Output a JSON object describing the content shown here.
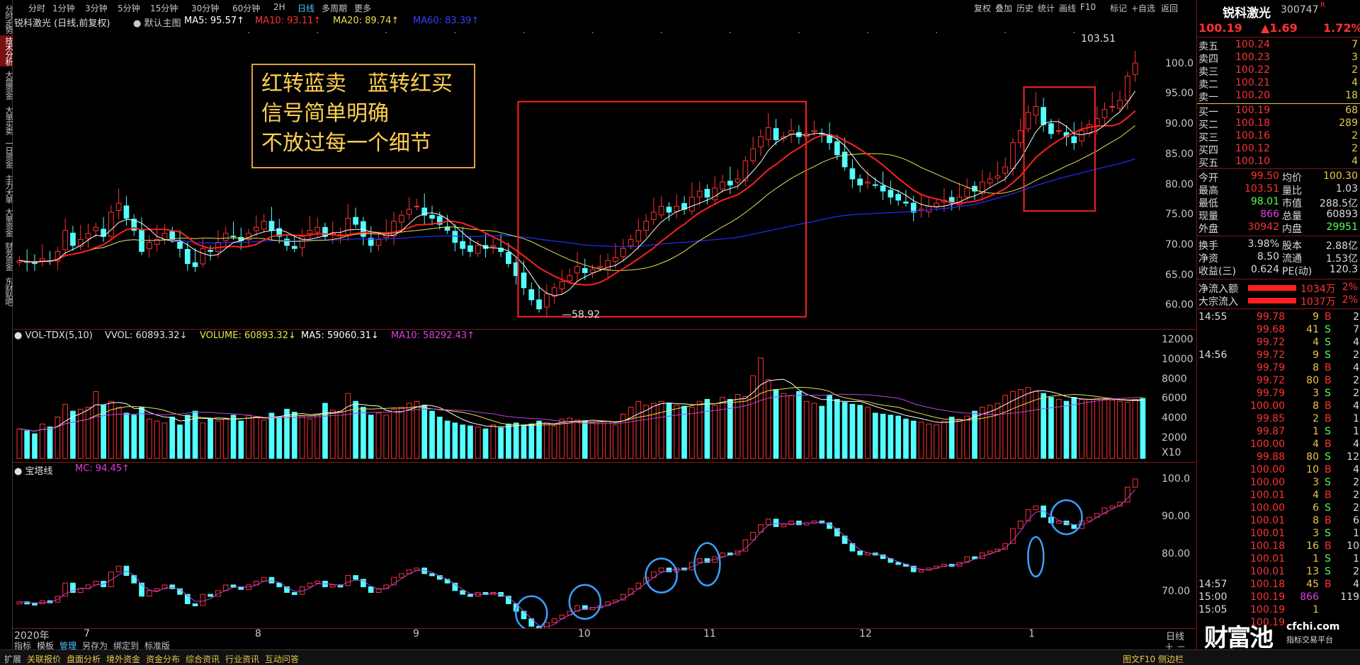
{
  "left_tabs": [
    "分时走势",
    "技术分析",
    "大盘资金",
    "大单买卖",
    "一日资金",
    "主力大单",
    "大单资金",
    "财务资金",
    "东财贴吧"
  ],
  "topbar": {
    "periods": [
      "分时",
      "1分钟",
      "3分钟",
      "5分钟",
      "15分钟",
      "30分钟",
      "60分钟",
      "2H",
      "日线",
      "多周期",
      "更多"
    ],
    "selected": "日线",
    "tools": [
      "复权",
      "叠加",
      "历史",
      "统计",
      "画线",
      "F10",
      "标记",
      "+自选",
      "返回"
    ]
  },
  "main_info": {
    "title": "锐科激光 (日线,前复权)",
    "template": "默认主图",
    "ma5": "MA5: 95.57↑",
    "ma10": "MA10: 93.11↑",
    "ma20": "MA20: 89.74↑",
    "ma60": "MA60: 83.39↑"
  },
  "annotation": [
    "红转蓝卖　蓝转红买",
    "信号简单明确",
    "不放过每一个细节"
  ],
  "price_labels": {
    "high": "103.51",
    "low": "58.92",
    "yaxis": [
      "100.0",
      "95.00",
      "90.00",
      "85.00",
      "80.00",
      "75.00",
      "70.00",
      "65.00",
      "60.00"
    ]
  },
  "vol_info": {
    "name": "VOL-TDX(5,10)",
    "vvol": "VVOL: 60893.32↓",
    "volume": "VOLUME: 60893.32↓",
    "ma5": "MA5: 59060.31↓",
    "ma10": "MA10: 58292.43↑",
    "yaxis": [
      "12000",
      "10000",
      "8000",
      "6000",
      "4000",
      "2000"
    ],
    "unit": "X10"
  },
  "tower_info": {
    "name": "宝塔线",
    "mc": "MC: 94.45↑",
    "yaxis": [
      "100.0",
      "90.00",
      "80.00",
      "70.00"
    ]
  },
  "xaxis": [
    "2020年",
    "7",
    "8",
    "9",
    "10",
    "11",
    "12",
    "1"
  ],
  "bottom_tools": [
    "指标",
    "模板",
    "管理",
    "另存为",
    "绑定到",
    "标准版"
  ],
  "period_label": "日线",
  "statusbar": [
    "扩展",
    "关联报价",
    "盘面分析",
    "境外资金",
    "资金分布",
    "综合资讯",
    "行业资讯",
    "互动问答"
  ],
  "status_right": "图文F10 侧边栏",
  "stock": {
    "name": "锐科激光",
    "code": "300747",
    "flag": "R",
    "price": "100.19",
    "change": "▲1.69",
    "pct": "1.72%"
  },
  "asks": [
    {
      "l": "卖五",
      "p": "100.24",
      "v": "7"
    },
    {
      "l": "卖四",
      "p": "100.23",
      "v": "3"
    },
    {
      "l": "卖三",
      "p": "100.22",
      "v": "2"
    },
    {
      "l": "卖二",
      "p": "100.21",
      "v": "4"
    },
    {
      "l": "卖一",
      "p": "100.20",
      "v": "18"
    }
  ],
  "bids": [
    {
      "l": "买一",
      "p": "100.19",
      "v": "68"
    },
    {
      "l": "买二",
      "p": "100.18",
      "v": "289"
    },
    {
      "l": "买三",
      "p": "100.16",
      "v": "2"
    },
    {
      "l": "买四",
      "p": "100.12",
      "v": "2"
    },
    {
      "l": "买五",
      "p": "100.10",
      "v": "4"
    }
  ],
  "stats1": [
    [
      "今开",
      "99.50",
      "均价",
      "100.30"
    ],
    [
      "最高",
      "103.51",
      "量比",
      "1.03"
    ],
    [
      "最低",
      "98.01",
      "市值",
      "288.5亿"
    ],
    [
      "现量",
      "866",
      "总量",
      "60893"
    ],
    [
      "外盘",
      "30942",
      "内盘",
      "29951"
    ]
  ],
  "stats2": [
    [
      "换手",
      "3.98%",
      "股本",
      "2.88亿"
    ],
    [
      "净资",
      "8.50",
      "流通",
      "1.53亿"
    ],
    [
      "收益(三)",
      "0.624",
      "PE(动)",
      "120.3"
    ]
  ],
  "flows": [
    {
      "l": "净流入额",
      "v": "1034万",
      "p": "2%"
    },
    {
      "l": "大宗流入",
      "v": "1037万",
      "p": "2%"
    }
  ],
  "ticks": [
    {
      "t": "14:55",
      "p": "99.78",
      "v": "9",
      "d": "B",
      "n": "2"
    },
    {
      "t": "",
      "p": "99.68",
      "v": "41",
      "d": "S",
      "n": "7"
    },
    {
      "t": "",
      "p": "99.72",
      "v": "4",
      "d": "S",
      "n": "4"
    },
    {
      "t": "14:56",
      "p": "99.72",
      "v": "9",
      "d": "S",
      "n": "2"
    },
    {
      "t": "",
      "p": "99.79",
      "v": "8",
      "d": "B",
      "n": "4"
    },
    {
      "t": "",
      "p": "99.72",
      "v": "80",
      "d": "B",
      "n": "2"
    },
    {
      "t": "",
      "p": "99.79",
      "v": "3",
      "d": "S",
      "n": "2"
    },
    {
      "t": "",
      "p": "100.00",
      "v": "8",
      "d": "B",
      "n": "4"
    },
    {
      "t": "",
      "p": "99.85",
      "v": "2",
      "d": "B",
      "n": "1"
    },
    {
      "t": "",
      "p": "99.87",
      "v": "1",
      "d": "S",
      "n": "1"
    },
    {
      "t": "",
      "p": "100.00",
      "v": "4",
      "d": "B",
      "n": "4"
    },
    {
      "t": "",
      "p": "99.88",
      "v": "80",
      "d": "S",
      "n": "12"
    },
    {
      "t": "",
      "p": "100.00",
      "v": "10",
      "d": "B",
      "n": "4"
    },
    {
      "t": "",
      "p": "100.00",
      "v": "3",
      "d": "S",
      "n": "2"
    },
    {
      "t": "",
      "p": "100.01",
      "v": "4",
      "d": "B",
      "n": "2"
    },
    {
      "t": "",
      "p": "100.00",
      "v": "6",
      "d": "S",
      "n": "2"
    },
    {
      "t": "",
      "p": "100.01",
      "v": "8",
      "d": "B",
      "n": "6"
    },
    {
      "t": "",
      "p": "100.01",
      "v": "3",
      "d": "S",
      "n": "1"
    },
    {
      "t": "",
      "p": "100.18",
      "v": "16",
      "d": "B",
      "n": "10"
    },
    {
      "t": "",
      "p": "100.01",
      "v": "1",
      "d": "S",
      "n": "1"
    },
    {
      "t": "",
      "p": "100.01",
      "v": "13",
      "d": "S",
      "n": "2"
    },
    {
      "t": "14:57",
      "p": "100.18",
      "v": "45",
      "d": "B",
      "n": "4"
    },
    {
      "t": "15:00",
      "p": "100.19",
      "v": "866",
      "d": "",
      "n": "119"
    },
    {
      "t": "15:05",
      "p": "100.19",
      "v": "1",
      "d": "",
      "n": ""
    },
    {
      "t": "",
      "p": "100.19",
      "v": "",
      "d": "",
      "n": ""
    }
  ],
  "watermark": {
    "main": "财富池",
    "site": "cfchi.com",
    "sub": "指标交易平台"
  },
  "colors": {
    "up": "#ff3232",
    "down": "#54ffff",
    "ma5": "#ffffff",
    "ma10": "#ff2020",
    "ma20": "#e8e050",
    "ma60": "#2030ff",
    "grid": "#7a1a1a",
    "annot": "#ffd050",
    "box": "#ff2020",
    "circle": "#3aa0ff"
  },
  "chart_data": {
    "type": "candlestick",
    "title": "锐科激光 (日线,前复权)",
    "ylim": [
      57,
      105
    ],
    "close": [
      67.5,
      67.2,
      67.0,
      67.8,
      67.4,
      69.0,
      72.5,
      70.0,
      71.0,
      72.0,
      73.0,
      71.5,
      75.5,
      77.0,
      74.5,
      72.5,
      69.0,
      70.5,
      71.0,
      72.0,
      71.0,
      69.5,
      67.0,
      66.5,
      69.5,
      69.0,
      70.5,
      72.0,
      71.5,
      70.8,
      72.0,
      73.0,
      74.0,
      72.5,
      71.5,
      70.0,
      69.5,
      71.5,
      72.5,
      73.0,
      71.5,
      72.0,
      71.8,
      74.5,
      73.5,
      71.5,
      70.0,
      71.0,
      72.0,
      74.0,
      75.0,
      76.0,
      76.5,
      75.0,
      74.5,
      73.5,
      72.5,
      70.5,
      69.5,
      69.0,
      70.0,
      69.5,
      70.0,
      69.0,
      67.0,
      65.0,
      63.0,
      61.0,
      59.5,
      62.0,
      63.0,
      64.0,
      65.0,
      66.5,
      65.5,
      66.0,
      66.5,
      67.5,
      68.0,
      69.5,
      71.0,
      72.5,
      74.0,
      75.5,
      76.5,
      75.5,
      76.5,
      76.0,
      78.0,
      79.0,
      78.0,
      79.5,
      80.5,
      80.0,
      81.0,
      84.0,
      86.0,
      88.0,
      89.5,
      87.5,
      88.0,
      89.0,
      88.0,
      88.5,
      89.0,
      88.5,
      87.0,
      85.0,
      83.0,
      81.0,
      80.0,
      80.5,
      80.0,
      79.0,
      78.0,
      77.5,
      77.0,
      75.5,
      76.0,
      76.5,
      77.0,
      77.5,
      77.0,
      78.0,
      79.5,
      79.0,
      80.5,
      81.0,
      81.5,
      83.0,
      87.0,
      89.0,
      92.0,
      93.0,
      90.0,
      88.5,
      89.0,
      88.0,
      87.0,
      89.0,
      90.0,
      91.0,
      92.5,
      93.0,
      94.0,
      98.0,
      100.19
    ],
    "volume": [
      3000,
      2800,
      2500,
      3500,
      3200,
      4200,
      5500,
      4800,
      5000,
      5200,
      6800,
      5400,
      5800,
      5200,
      4600,
      4400,
      5200,
      4000,
      3800,
      3600,
      4200,
      3400,
      4400,
      4800,
      3600,
      4000,
      3800,
      4100,
      4400,
      3800,
      4400,
      4200,
      3900,
      4600,
      4200,
      5000,
      4700,
      4300,
      4000,
      4500,
      5600,
      4900,
      4800,
      6600,
      5800,
      5200,
      4400,
      4600,
      4400,
      5000,
      5200,
      5600,
      5800,
      5400,
      4800,
      4200,
      3800,
      3600,
      3400,
      3300,
      3200,
      3000,
      3400,
      3100,
      3500,
      3600,
      3400,
      3500,
      3800,
      3600,
      3300,
      4000,
      4100,
      3900,
      3800,
      3600,
      3700,
      3800,
      3400,
      4500,
      5200,
      5800,
      5400,
      5600,
      5800,
      5600,
      5400,
      5300,
      5200,
      5800,
      6000,
      5400,
      6200,
      6000,
      6500,
      6300,
      8400,
      10200,
      8000,
      7000,
      6600,
      6400,
      6800,
      5800,
      5600,
      5300,
      6400,
      6000,
      5700,
      5500,
      5400,
      5200,
      4600,
      4500,
      4400,
      4300,
      4000,
      3800,
      3700,
      3500,
      3400,
      3800,
      4200,
      4000,
      4300,
      4800,
      5200,
      5400,
      5600,
      6400,
      6800,
      7000,
      7200,
      6800,
      6600,
      6200,
      6000,
      5800,
      6200,
      6000,
      6000,
      6100,
      6000,
      5900,
      5800,
      5700,
      6000,
      6100
    ]
  }
}
